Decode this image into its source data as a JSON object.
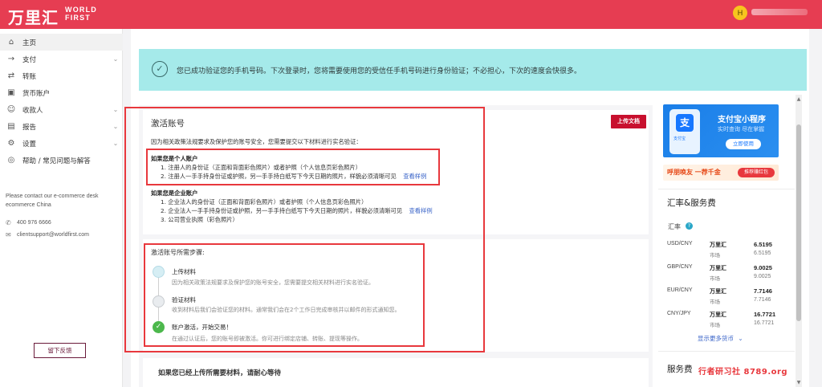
{
  "header": {
    "logo_cn": "万里汇",
    "logo_en_line1": "WORLD",
    "logo_en_line2": "FIRST",
    "avatar_letter": "H"
  },
  "sidebar": {
    "items": [
      {
        "label": "主页",
        "icon": "home-icon",
        "active": true
      },
      {
        "label": "支付",
        "icon": "arrow-right-icon",
        "has_children": true
      },
      {
        "label": "转账",
        "icon": "transfer-icon"
      },
      {
        "label": "货币账户",
        "icon": "wallet-icon"
      },
      {
        "label": "收款人",
        "icon": "users-icon",
        "has_children": true
      },
      {
        "label": "报告",
        "icon": "report-icon",
        "has_children": true
      },
      {
        "label": "设置",
        "icon": "gear-icon",
        "has_children": true
      },
      {
        "label": "帮助 / 常见问题与解答",
        "icon": "help-icon"
      }
    ],
    "contact_note": "Please contact our e-commerce desk ecommerce China",
    "phone": "400 976 6666",
    "email": "clientsupport@worldfirst.com",
    "feedback_label": "留下反馈"
  },
  "banner": {
    "message": "您已成功验证您的手机号码。下次登录时，您将需要使用您的受信任手机号码进行身份验证；不必担心，下次的速度会快很多。"
  },
  "activate": {
    "title": "激活账号",
    "upload_label": "上传文档",
    "intro": "因为相关政策法规要求及保护您的账号安全，您需要提交以下材料进行实名验证：",
    "personal_heading": "如果您是个人账户",
    "personal_items": [
      "1. 注册人的身份证（正面和背面彩色照片）或者护照（个人信息页彩色照片）",
      "2. 注册人一手手持身份证或护照，另一手手持白纸写下今天日期的照片，样貌必须清晰可见"
    ],
    "personal_example": "查看样例",
    "company_heading": "如果您是企业账户",
    "company_items": [
      "1. 企业法人的身份证（正面和背面彩色照片）或者护照（个人信息页彩色照片）",
      "2. 企业法人一手手持身份证或护照，另一手手持白纸写下今天日期的照片，样貌必须清晰可见",
      "3. 公司营业执照（彩色照片）"
    ],
    "company_example": "查看样例"
  },
  "steps": {
    "title": "激活账号所需步骤:",
    "items": [
      {
        "title": "上传材料",
        "desc": "因为相关政策法规要求及保护您的账号安全，您需要提交相关材料进行实名验证。"
      },
      {
        "title": "验证材料",
        "desc": "收到材料后我们会验证您的材料。通常我们会在2个工作日完成审核并以邮件的形式通知您。"
      },
      {
        "title": "账户激活，开始交易！",
        "desc": "在通过认证后，您的账号即被激活。你可进行绑定店铺、转账、提现等操作。"
      }
    ]
  },
  "pending": {
    "text": "如果您已经上传所需要材料，请耐心等待"
  },
  "promo": {
    "alipay_title": "支付宝小程序",
    "alipay_sub": "实时查询 尽在掌握",
    "alipay_btn": "立即使用",
    "alipay_logo": "支",
    "alipay_logo_sub": "支付宝",
    "invite_text": "呼朋唤友 一荐千金",
    "invite_btn": "推荐赚红包"
  },
  "rates": {
    "section_title": "汇率&服务费",
    "rate_label": "汇率",
    "brand_label": "万里汇",
    "market_label": "市场",
    "pairs": [
      {
        "pair": "USD/CNY",
        "wf": "6.5195",
        "market": "6.5195"
      },
      {
        "pair": "GBP/CNY",
        "wf": "9.0025",
        "market": "9.0025"
      },
      {
        "pair": "EUR/CNY",
        "wf": "7.7146",
        "market": "7.7146"
      },
      {
        "pair": "CNY/JPY",
        "wf": "16.7721",
        "market": "16.7721"
      }
    ],
    "more_link": "显示更多货币",
    "service_fee_title": "服务费"
  },
  "watermark": "行者研习社 8789.org"
}
